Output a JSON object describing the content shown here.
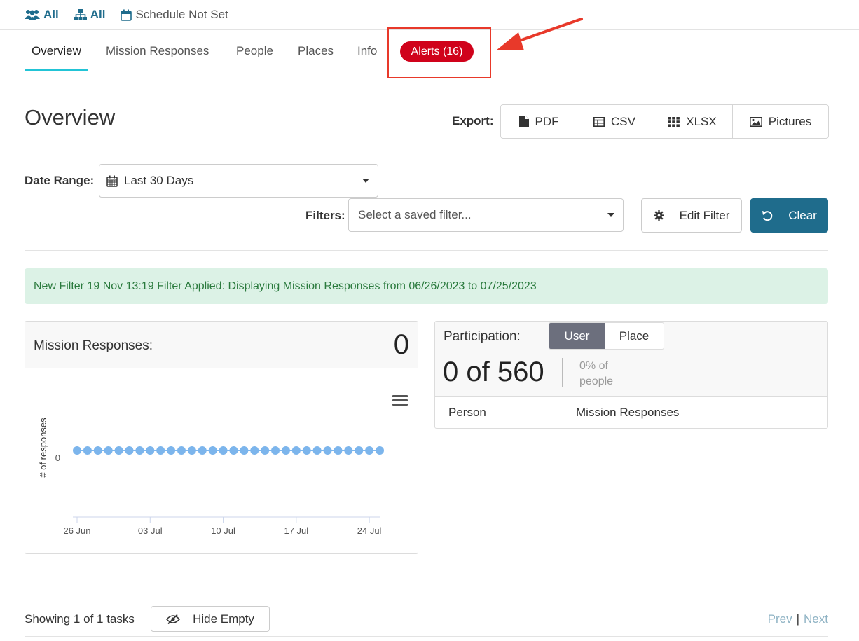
{
  "topbar": {
    "users_label": "All",
    "orgs_label": "All",
    "schedule_label": "Schedule Not Set"
  },
  "tabs": {
    "overview": "Overview",
    "mission_responses": "Mission Responses",
    "people": "People",
    "places": "Places",
    "info": "Info",
    "alerts": "Alerts (16)"
  },
  "page": {
    "title": "Overview"
  },
  "export": {
    "label": "Export:",
    "pdf": "PDF",
    "csv": "CSV",
    "xlsx": "XLSX",
    "pictures": "Pictures"
  },
  "date_range": {
    "label": "Date Range:",
    "value": "Last 30 Days"
  },
  "filters": {
    "label": "Filters:",
    "placeholder": "Select a saved filter...",
    "edit_label": "Edit Filter",
    "clear_label": "Clear"
  },
  "banner": {
    "text": "New Filter 19 Nov 13:19 Filter Applied: Displaying Mission Responses from 06/26/2023 to 07/25/2023"
  },
  "mission_panel": {
    "title": "Mission Responses:",
    "count": "0"
  },
  "chart_data": {
    "type": "line",
    "x_start": "2023-06-26",
    "x_end": "2023-07-25",
    "values": [
      0,
      0,
      0,
      0,
      0,
      0,
      0,
      0,
      0,
      0,
      0,
      0,
      0,
      0,
      0,
      0,
      0,
      0,
      0,
      0,
      0,
      0,
      0,
      0,
      0,
      0,
      0,
      0,
      0,
      0
    ],
    "ylabel": "# of responses",
    "y_ticks": [
      "0"
    ],
    "x_ticks": [
      "26 Jun",
      "03 Jul",
      "10 Jul",
      "17 Jul",
      "24 Jul"
    ],
    "point_color": "#7cb5ec"
  },
  "participation": {
    "label": "Participation:",
    "toggle_user": "User",
    "toggle_place": "Place",
    "count_text": "0 of 560",
    "percent_line1": "0% of",
    "percent_line2": "people",
    "col_person": "Person",
    "col_responses": "Mission Responses"
  },
  "footer": {
    "showing": "Showing 1 of 1 tasks",
    "hide_empty": "Hide Empty",
    "prev": "Prev",
    "separator": "|",
    "next": "Next"
  },
  "colors": {
    "brand": "#1f6c8c",
    "alert": "#d0021b",
    "annotation": "#e8392a",
    "active_tab": "#22c4d6",
    "success_bg": "#dcf2e6"
  }
}
